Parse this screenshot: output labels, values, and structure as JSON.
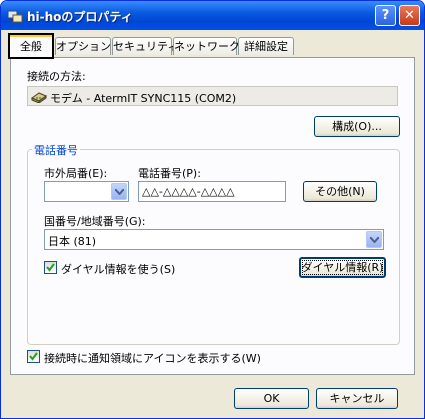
{
  "window": {
    "title": "hi-hoのプロパティ",
    "help_label": "?",
    "close_label": "✕"
  },
  "tabs": [
    {
      "label": "全般",
      "active": true
    },
    {
      "label": "オプション",
      "active": false
    },
    {
      "label": "セキュリティ",
      "active": false
    },
    {
      "label": "ネットワーク",
      "active": false
    },
    {
      "label": "詳細設定",
      "active": false
    }
  ],
  "connect_method": {
    "label": "接続の方法:",
    "device": "モデム - AtermIT SYNC115 (COM2)",
    "device_icon": "modem-icon",
    "configure_label": "構成(O)..."
  },
  "phone": {
    "group_title": "電話番号",
    "area_code_label": "市外局番(E):",
    "area_code_value": "",
    "phone_number_label": "電話番号(P):",
    "phone_number_value": "△△-△△△△-△△△△",
    "other_label": "その他(N)",
    "country_label": "国番号/地域番号(G):",
    "country_value": "日本 (81)",
    "use_dialing_rules_label": "ダイヤル情報を使う(S)",
    "use_dialing_rules_checked": true,
    "dialing_rules_button": "ダイヤル情報(R)"
  },
  "notify": {
    "label": "接続時に通知領域にアイコンを表示する(W)",
    "checked": true
  },
  "footer": {
    "ok_label": "OK",
    "cancel_label": "キャンセル"
  }
}
